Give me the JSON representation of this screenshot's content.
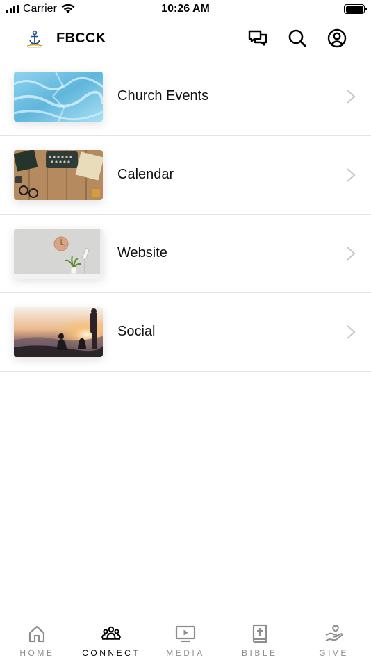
{
  "status_bar": {
    "carrier": "Carrier",
    "time": "10:26 AM"
  },
  "header": {
    "title": "FBCCK",
    "icons": [
      "chat-icon",
      "search-icon",
      "account-icon"
    ]
  },
  "list": {
    "items": [
      {
        "label": "Church Events",
        "thumb": "blue-water-thumbnail"
      },
      {
        "label": "Calendar",
        "thumb": "desk-typewriter-thumbnail"
      },
      {
        "label": "Website",
        "thumb": "wall-clock-plant-thumbnail"
      },
      {
        "label": "Social",
        "thumb": "sunset-people-thumbnail"
      }
    ]
  },
  "tab_bar": {
    "tabs": [
      {
        "label": "HOME",
        "icon": "home-icon",
        "active": false
      },
      {
        "label": "CONNECT",
        "icon": "people-icon",
        "active": true
      },
      {
        "label": "MEDIA",
        "icon": "play-screen-icon",
        "active": false
      },
      {
        "label": "BIBLE",
        "icon": "book-cross-icon",
        "active": false
      },
      {
        "label": "GIVE",
        "icon": "heart-hand-icon",
        "active": false
      }
    ]
  },
  "colors": {
    "active_tab": "#000000",
    "inactive_tab": "#8e8e8e",
    "divider": "#e4e4e4"
  }
}
